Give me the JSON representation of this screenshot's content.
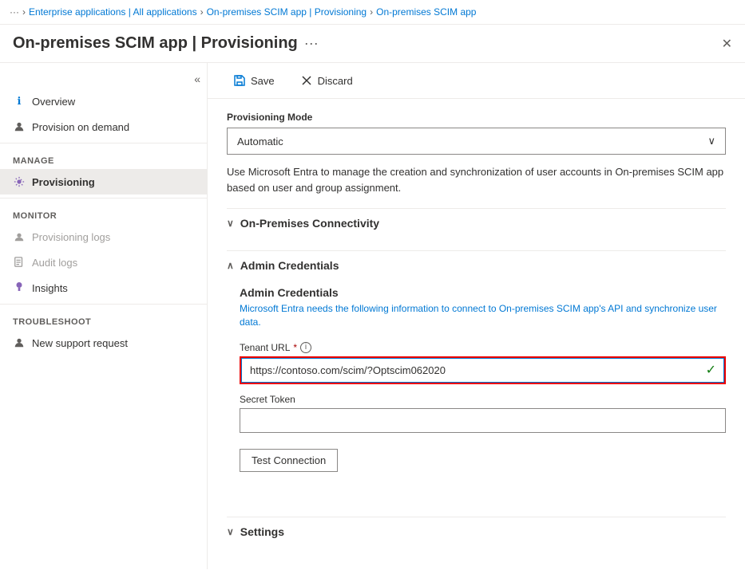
{
  "breadcrumb": {
    "dots": "···",
    "items": [
      {
        "label": "Enterprise applications | All applications",
        "link": true
      },
      {
        "label": "On-premises SCIM app | Provisioning",
        "link": true
      },
      {
        "label": "On-premises SCIM app",
        "link": true
      }
    ]
  },
  "header": {
    "title": "On-premises SCIM app | Provisioning",
    "dots": "···",
    "close": "✕"
  },
  "toolbar": {
    "save_label": "Save",
    "discard_label": "Discard"
  },
  "sidebar": {
    "collapse_icon": "«",
    "items": [
      {
        "id": "overview",
        "label": "Overview",
        "icon": "ℹ",
        "active": false,
        "disabled": false,
        "section": null
      },
      {
        "id": "provision-on-demand",
        "label": "Provision on demand",
        "icon": "👤",
        "active": false,
        "disabled": false,
        "section": null
      },
      {
        "id": "manage-label",
        "label": "Manage",
        "type": "section"
      },
      {
        "id": "provisioning",
        "label": "Provisioning",
        "icon": "⚙",
        "active": true,
        "disabled": false,
        "section": "manage"
      },
      {
        "id": "monitor-label",
        "label": "Monitor",
        "type": "section"
      },
      {
        "id": "prov-logs",
        "label": "Provisioning logs",
        "icon": "👤",
        "active": false,
        "disabled": true,
        "section": "monitor"
      },
      {
        "id": "audit-logs",
        "label": "Audit logs",
        "icon": "📋",
        "active": false,
        "disabled": true,
        "section": "monitor"
      },
      {
        "id": "insights",
        "label": "Insights",
        "icon": "💡",
        "active": false,
        "disabled": false,
        "section": "monitor"
      },
      {
        "id": "troubleshoot-label",
        "label": "Troubleshoot",
        "type": "section"
      },
      {
        "id": "new-support",
        "label": "New support request",
        "icon": "👤",
        "active": false,
        "disabled": false,
        "section": "troubleshoot"
      }
    ]
  },
  "main": {
    "provisioning_mode_label": "Provisioning Mode",
    "provisioning_mode_value": "Automatic",
    "description": "Use Microsoft Entra to manage the creation and synchronization of user accounts in On-premises SCIM app based on user and group assignment.",
    "sections": [
      {
        "id": "on-premises-connectivity",
        "label": "On-Premises Connectivity",
        "expanded": false,
        "chevron": "∨"
      },
      {
        "id": "admin-credentials",
        "label": "Admin Credentials",
        "expanded": true,
        "chevron": "∧"
      }
    ],
    "admin_credentials": {
      "title": "Admin Credentials",
      "description": "Microsoft Entra needs the following information to connect to On-premises SCIM app's API and synchronize user data.",
      "tenant_url_label": "Tenant URL",
      "tenant_url_required": "*",
      "tenant_url_value": "https://contoso.com/scim/?Optscim062020",
      "secret_token_label": "Secret Token",
      "secret_token_value": "",
      "test_connection_label": "Test Connection"
    },
    "settings_section": {
      "label": "Settings",
      "chevron": "∨",
      "expanded": false
    }
  }
}
